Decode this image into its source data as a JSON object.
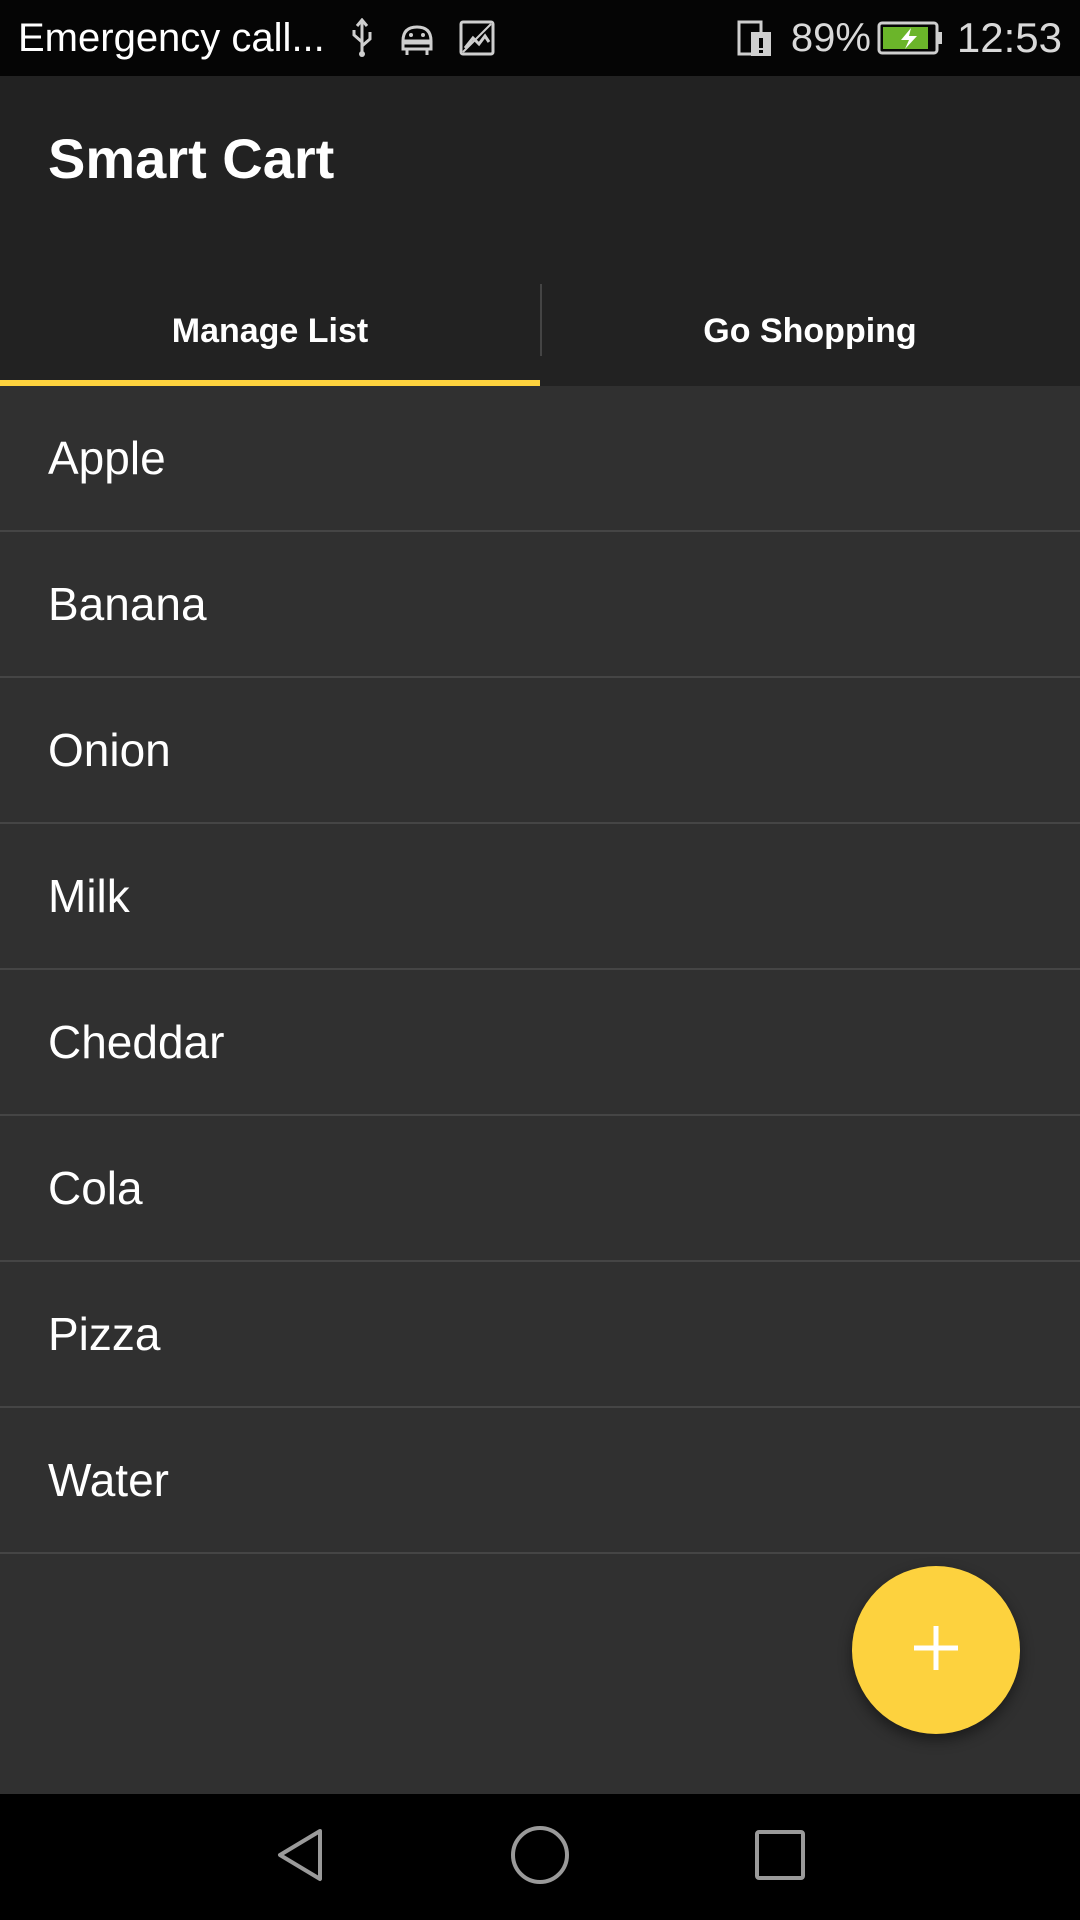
{
  "statusbar": {
    "carrier": "Emergency call...",
    "battery_percent": "89%",
    "time": "12:53",
    "icons": [
      "usb-icon",
      "android-debug-icon",
      "image-icon",
      "sim-icon",
      "battery-charging-icon"
    ],
    "battery_level": 0.89
  },
  "appbar": {
    "title": "Smart Cart",
    "tabs": [
      {
        "label": "Manage List",
        "selected": true
      },
      {
        "label": "Go Shopping",
        "selected": false
      }
    ]
  },
  "list": {
    "items": [
      "Apple",
      "Banana",
      "Onion",
      "Milk",
      "Cheddar",
      "Cola",
      "Pizza",
      "Water"
    ]
  },
  "fab": {
    "icon": "plus-icon"
  },
  "navbar": {
    "icons": [
      "back-icon",
      "home-icon",
      "recents-icon"
    ]
  },
  "colors": {
    "accent": "#fdd23e",
    "appbar_bg": "#222222",
    "content_bg": "#303030",
    "battery_fill": "#6bb52a"
  }
}
